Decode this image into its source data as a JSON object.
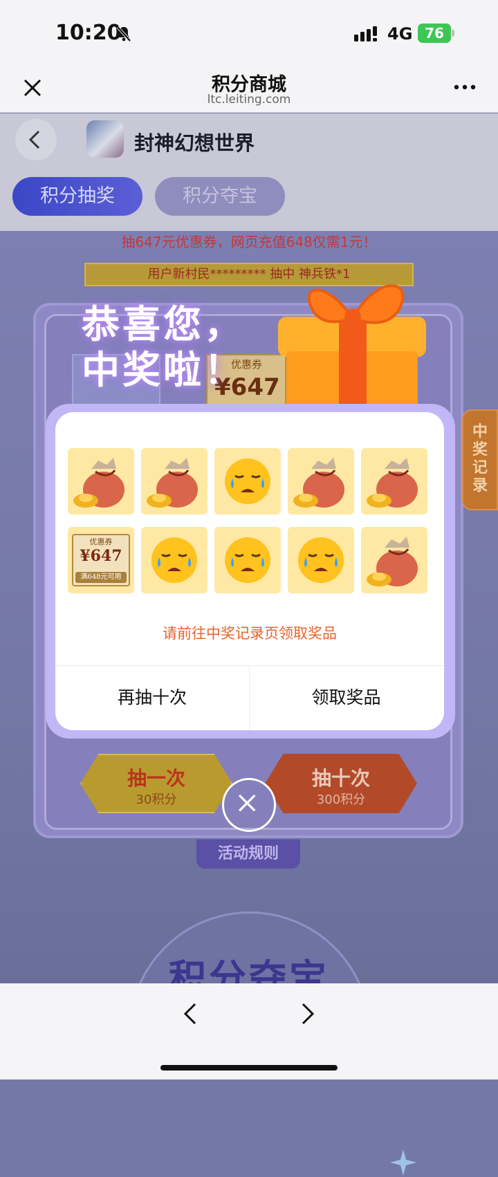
{
  "status_bar": {
    "time": "10:20",
    "network": "4G",
    "battery": "76"
  },
  "browser": {
    "title": "积分商城",
    "url": "ltc.leiting.com"
  },
  "page": {
    "game_name": "封神幻想世界",
    "tabs": [
      {
        "label": "积分抽奖"
      },
      {
        "label": "积分夺宝"
      }
    ],
    "promo_text": "抽647元优惠券，网页充值648仅需1元！",
    "ticker_text": "用户新村民********* 抽中 神兵铁*1",
    "draw_once": {
      "label": "抽一次",
      "cost": "30积分"
    },
    "draw_ten": {
      "label": "抽十次",
      "cost": "300积分"
    },
    "rules_label": "活动规则",
    "treasure_heading": "积分夺宝",
    "record_tab": "中奖记录",
    "peek_coupon": {
      "tag": "优惠券",
      "amount": "¥647"
    }
  },
  "modal": {
    "heading_line1": "恭喜您，",
    "heading_line2": "中奖啦！",
    "prizes": [
      {
        "type": "bag"
      },
      {
        "type": "bag"
      },
      {
        "type": "cry"
      },
      {
        "type": "bag"
      },
      {
        "type": "bag"
      },
      {
        "type": "coupon"
      },
      {
        "type": "cry"
      },
      {
        "type": "cry"
      },
      {
        "type": "cry"
      },
      {
        "type": "bag"
      }
    ],
    "coupon": {
      "tag": "优惠券",
      "amount": "¥647",
      "condition": "满648元可用"
    },
    "hint": "请前往中奖记录页领取奖品",
    "retry_label": "再抽十次",
    "claim_label": "领取奖品"
  },
  "colors": {
    "hint": "#e8612b",
    "tab_active": "#3b47c7",
    "prize_bg": "#ffe8a3",
    "modal_frame": "#c1b7f6"
  }
}
